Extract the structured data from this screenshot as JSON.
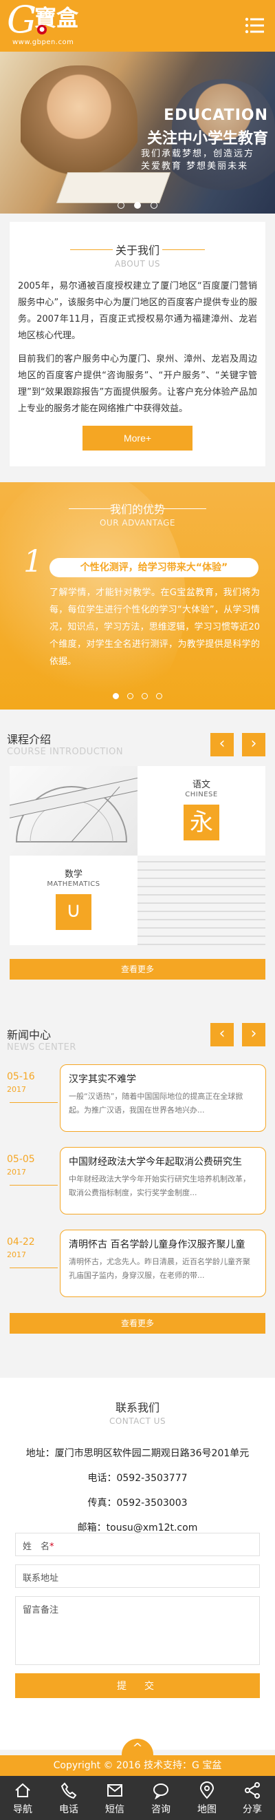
{
  "header": {
    "logo_text": "G寶盒",
    "logo_g": "G",
    "logo_cn": "寶盒",
    "logo_url": "www.gbpen.com",
    "menu_icon": "menu-icon"
  },
  "banner": {
    "title_en": "EDUCATION",
    "title_cn": "关注中小学生教育",
    "subtitle": "我们承载梦想，创造远方 关爱教育 梦想美丽未来"
  },
  "about": {
    "title_cn": "关于我们",
    "title_en": "ABOUT US",
    "para1": "2005年，易尔通被百度授权建立了厦门地区“百度厦门营销服务中心”，该服务中心为厦门地区的百度客户提供专业的服务。2007年11月，百度正式授权易尔通为福建漳州、龙岩地区核心代理。",
    "para2": "目前我们的客户服务中心为厦门、泉州、漳州、龙岩及周边地区的百度客户提供“咨询服务”、“开户服务”、“关键字管理”到“效果跟踪报告”方面提供服务。让客户充分体验产品加上专业的服务才能在网络推广中获得效益。",
    "more": "More+"
  },
  "advantage": {
    "title_cn": "我们的优势",
    "title_en": "OUR ADVANTAGE",
    "number": "1",
    "headline": "个性化测评，给学习带来大“体验”",
    "text": "了解学情，才能针对教学。在G宝盆教育，我们将为每，每位学生进行个性化的学习“大体验”，从学习情况，知识点，学习方法，思维逻辑，学习习惯等近20个维度，对学生全名进行测评，为教学提供是科学的依据。"
  },
  "course": {
    "title_cn": "课程介绍",
    "title_en": "COURSE INTRODUCTION",
    "prev": "‹",
    "next": "›",
    "items": [
      {
        "name": "语文",
        "en": "CHINESE",
        "icon": "永"
      },
      {
        "name": "数学",
        "en": "MATHEMATICS",
        "icon": "∪"
      }
    ],
    "more": "查看更多"
  },
  "news": {
    "title_cn": "新闻中心",
    "title_en": "NEWS CENTER",
    "prev": "‹",
    "next": "›",
    "items": [
      {
        "date": "05-16",
        "year": "2017",
        "title": "汉字其实不难学",
        "desc": "一般“汉语热”，随着中国国际地位的提高正在全球掀起。为推广汉语，我国在世界各地兴办..."
      },
      {
        "date": "05-05",
        "year": "2017",
        "title": "中国财经政法大学今年起取消公费研究生",
        "desc": "中年财经政法大学今年开始实行研究生培养机制改革，取消公费指标制度，实行奖学金制度..."
      },
      {
        "date": "04-22",
        "year": "2017",
        "title": "清明怀古 百名学龄儿童身作汉服齐聚儿童",
        "desc": "清明怀古，尤念先人。昨日清晨，近百名学龄儿童齐聚孔庙国子监内，身穿汉服，在老师的带..."
      }
    ],
    "more": "查看更多"
  },
  "contact": {
    "title_cn": "联系我们",
    "title_en": "CONTACT US",
    "address": "地址：厦门市思明区软件园二期观日路36号201单元",
    "phone": "电话：0592-3503777",
    "fax": "传真：0592-3503003",
    "email": "邮箱：tousu@xm12t.com",
    "name_label": "姓　名",
    "addr_label": "联系地址",
    "msg_label": "留言备注",
    "star": "*",
    "submit": "提　交"
  },
  "footer": {
    "copyright": "Copyright © 2016  技术支持：G 宝盆",
    "up_icon": "^"
  },
  "nav": [
    {
      "label": "导航",
      "icon": "home-icon"
    },
    {
      "label": "电话",
      "icon": "phone-icon"
    },
    {
      "label": "短信",
      "icon": "sms-icon"
    },
    {
      "label": "咨询",
      "icon": "chat-icon"
    },
    {
      "label": "地图",
      "icon": "map-icon"
    },
    {
      "label": "分享",
      "icon": "share-icon"
    }
  ],
  "colors": {
    "accent": "#f5a623",
    "nav_bg": "#333333",
    "seal": "#d0021b"
  }
}
